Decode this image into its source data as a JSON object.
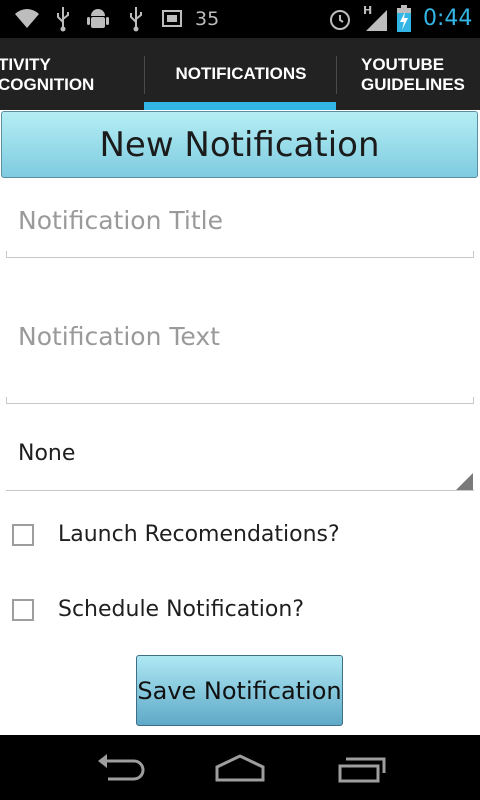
{
  "status_bar": {
    "notification_count": "35",
    "network_type": "H",
    "clock": "0:44",
    "icons": [
      "wifi-icon",
      "usb-icon",
      "android-debug-icon",
      "usb-icon",
      "screenshot-icon",
      "alarm-icon",
      "signal-icon",
      "battery-charging-icon"
    ],
    "accent_color": "#33b5e5"
  },
  "tabs": {
    "left": {
      "line1": "TIVITY",
      "line2": "COGNITION"
    },
    "center": {
      "label": "NOTIFICATIONS"
    },
    "right": {
      "line1": "YOUTUBE",
      "line2": "GUIDELINES"
    },
    "indicator_color": "#33b5e5"
  },
  "form": {
    "header_button": "New Notification",
    "title_placeholder": "Notification Title",
    "text_placeholder": "Notification Text",
    "spinner_value": "None",
    "launch_checkbox": {
      "label": "Launch Recomendations?",
      "checked": false
    },
    "schedule_checkbox": {
      "label": "Schedule Notification?",
      "checked": false
    },
    "save_button": "Save Notification"
  },
  "nav_bar": {
    "icons": [
      "back-icon",
      "home-icon",
      "recent-apps-icon"
    ]
  }
}
